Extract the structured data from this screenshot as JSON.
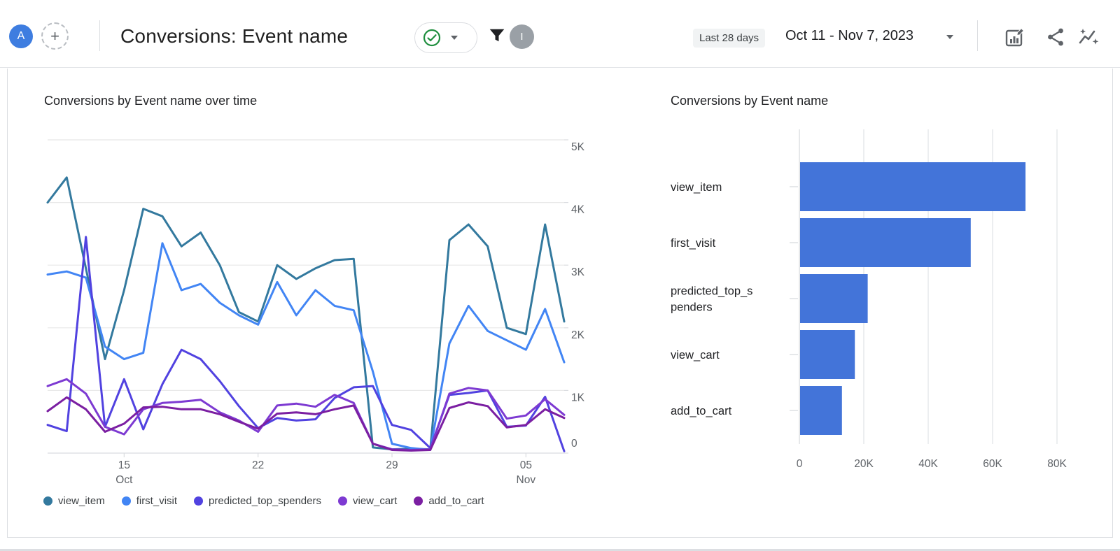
{
  "header": {
    "avatar_letter": "A",
    "add_button_glyph": "+",
    "title": "Conversions: Event name",
    "collaborator_letter": "I",
    "date_preset": "Last 28 days",
    "date_range": "Oct 11 - Nov 7, 2023",
    "icon_names": [
      "customize-report-icon",
      "share-icon",
      "insights-icon"
    ],
    "status_icon": "approved-check-icon"
  },
  "colors": {
    "bar_fill": "#4374D9",
    "check_green": "#1e8e3e",
    "grid": "#e8e8e8",
    "axis": "#dadce0",
    "tick_text": "#5f6368"
  },
  "chart_data": [
    {
      "type": "line",
      "title": "Conversions by Event name over time",
      "x": [
        "Oct 11",
        "Oct 12",
        "Oct 13",
        "Oct 14",
        "Oct 15",
        "Oct 16",
        "Oct 17",
        "Oct 18",
        "Oct 19",
        "Oct 20",
        "Oct 21",
        "Oct 22",
        "Oct 23",
        "Oct 24",
        "Oct 25",
        "Oct 26",
        "Oct 27",
        "Oct 28",
        "Oct 29",
        "Oct 30",
        "Oct 31",
        "Nov 1",
        "Nov 2",
        "Nov 3",
        "Nov 4",
        "Nov 5",
        "Nov 6",
        "Nov 7"
      ],
      "x_tick_labels": [
        {
          "index": 4,
          "line1": "15",
          "line2": "Oct"
        },
        {
          "index": 11,
          "line1": "22",
          "line2": ""
        },
        {
          "index": 18,
          "line1": "29",
          "line2": ""
        },
        {
          "index": 25,
          "line1": "05",
          "line2": "Nov"
        }
      ],
      "ylim": [
        0,
        5000
      ],
      "y_ticks": [
        {
          "v": 0,
          "label": "0"
        },
        {
          "v": 1000,
          "label": "1K"
        },
        {
          "v": 2000,
          "label": "2K"
        },
        {
          "v": 3000,
          "label": "3K"
        },
        {
          "v": 4000,
          "label": "4K"
        },
        {
          "v": 5000,
          "label": "5K"
        }
      ],
      "grid": true,
      "legend_position": "bottom",
      "series": [
        {
          "name": "view_item",
          "color": "#33799E",
          "values": [
            4000,
            4400,
            2950,
            1500,
            2600,
            3900,
            3780,
            3300,
            3520,
            3000,
            2250,
            2100,
            3000,
            2780,
            2950,
            3080,
            3100,
            90,
            60,
            70,
            60,
            3400,
            3650,
            3300,
            2000,
            1900,
            3650,
            2100
          ]
        },
        {
          "name": "first_visit",
          "color": "#4285F4",
          "values": [
            2850,
            2900,
            2800,
            1700,
            1500,
            1600,
            3350,
            2600,
            2700,
            2400,
            2200,
            2050,
            2730,
            2200,
            2600,
            2350,
            2280,
            1300,
            150,
            80,
            50,
            1750,
            2350,
            1950,
            1800,
            1650,
            2300,
            1450
          ]
        },
        {
          "name": "predicted_top_spenders",
          "color": "#5142E0",
          "values": [
            450,
            350,
            3450,
            420,
            1180,
            380,
            1100,
            1650,
            1500,
            1150,
            750,
            400,
            560,
            520,
            540,
            880,
            1050,
            1070,
            450,
            370,
            80,
            930,
            960,
            1000,
            420,
            440,
            900,
            30
          ]
        },
        {
          "name": "view_cart",
          "color": "#7D3AD2",
          "values": [
            1070,
            1180,
            950,
            420,
            300,
            700,
            800,
            820,
            850,
            650,
            520,
            340,
            760,
            790,
            740,
            930,
            800,
            150,
            60,
            50,
            60,
            950,
            1040,
            1000,
            550,
            600,
            860,
            610
          ]
        },
        {
          "name": "add_to_cart",
          "color": "#7B1FA2",
          "values": [
            670,
            890,
            700,
            340,
            470,
            730,
            740,
            700,
            700,
            620,
            500,
            390,
            630,
            650,
            620,
            700,
            760,
            150,
            50,
            40,
            50,
            720,
            810,
            750,
            410,
            450,
            700,
            560
          ]
        }
      ]
    },
    {
      "type": "bar",
      "title": "Conversions by Event name",
      "orientation": "horizontal",
      "categories": [
        "view_item",
        "first_visit",
        "predicted_top_spenders",
        "view_cart",
        "add_to_cart"
      ],
      "category_display": [
        [
          "view_item"
        ],
        [
          "first_visit"
        ],
        [
          "predicted_top_s",
          "penders"
        ],
        [
          "view_cart"
        ],
        [
          "add_to_cart"
        ]
      ],
      "values": [
        70000,
        53000,
        21000,
        17000,
        13000
      ],
      "xlim": [
        0,
        80000
      ],
      "x_ticks": [
        {
          "v": 0,
          "label": "0"
        },
        {
          "v": 20000,
          "label": "20K"
        },
        {
          "v": 40000,
          "label": "40K"
        },
        {
          "v": 60000,
          "label": "60K"
        },
        {
          "v": 80000,
          "label": "80K"
        }
      ],
      "bar_color": "#4374D9",
      "grid": true
    }
  ]
}
